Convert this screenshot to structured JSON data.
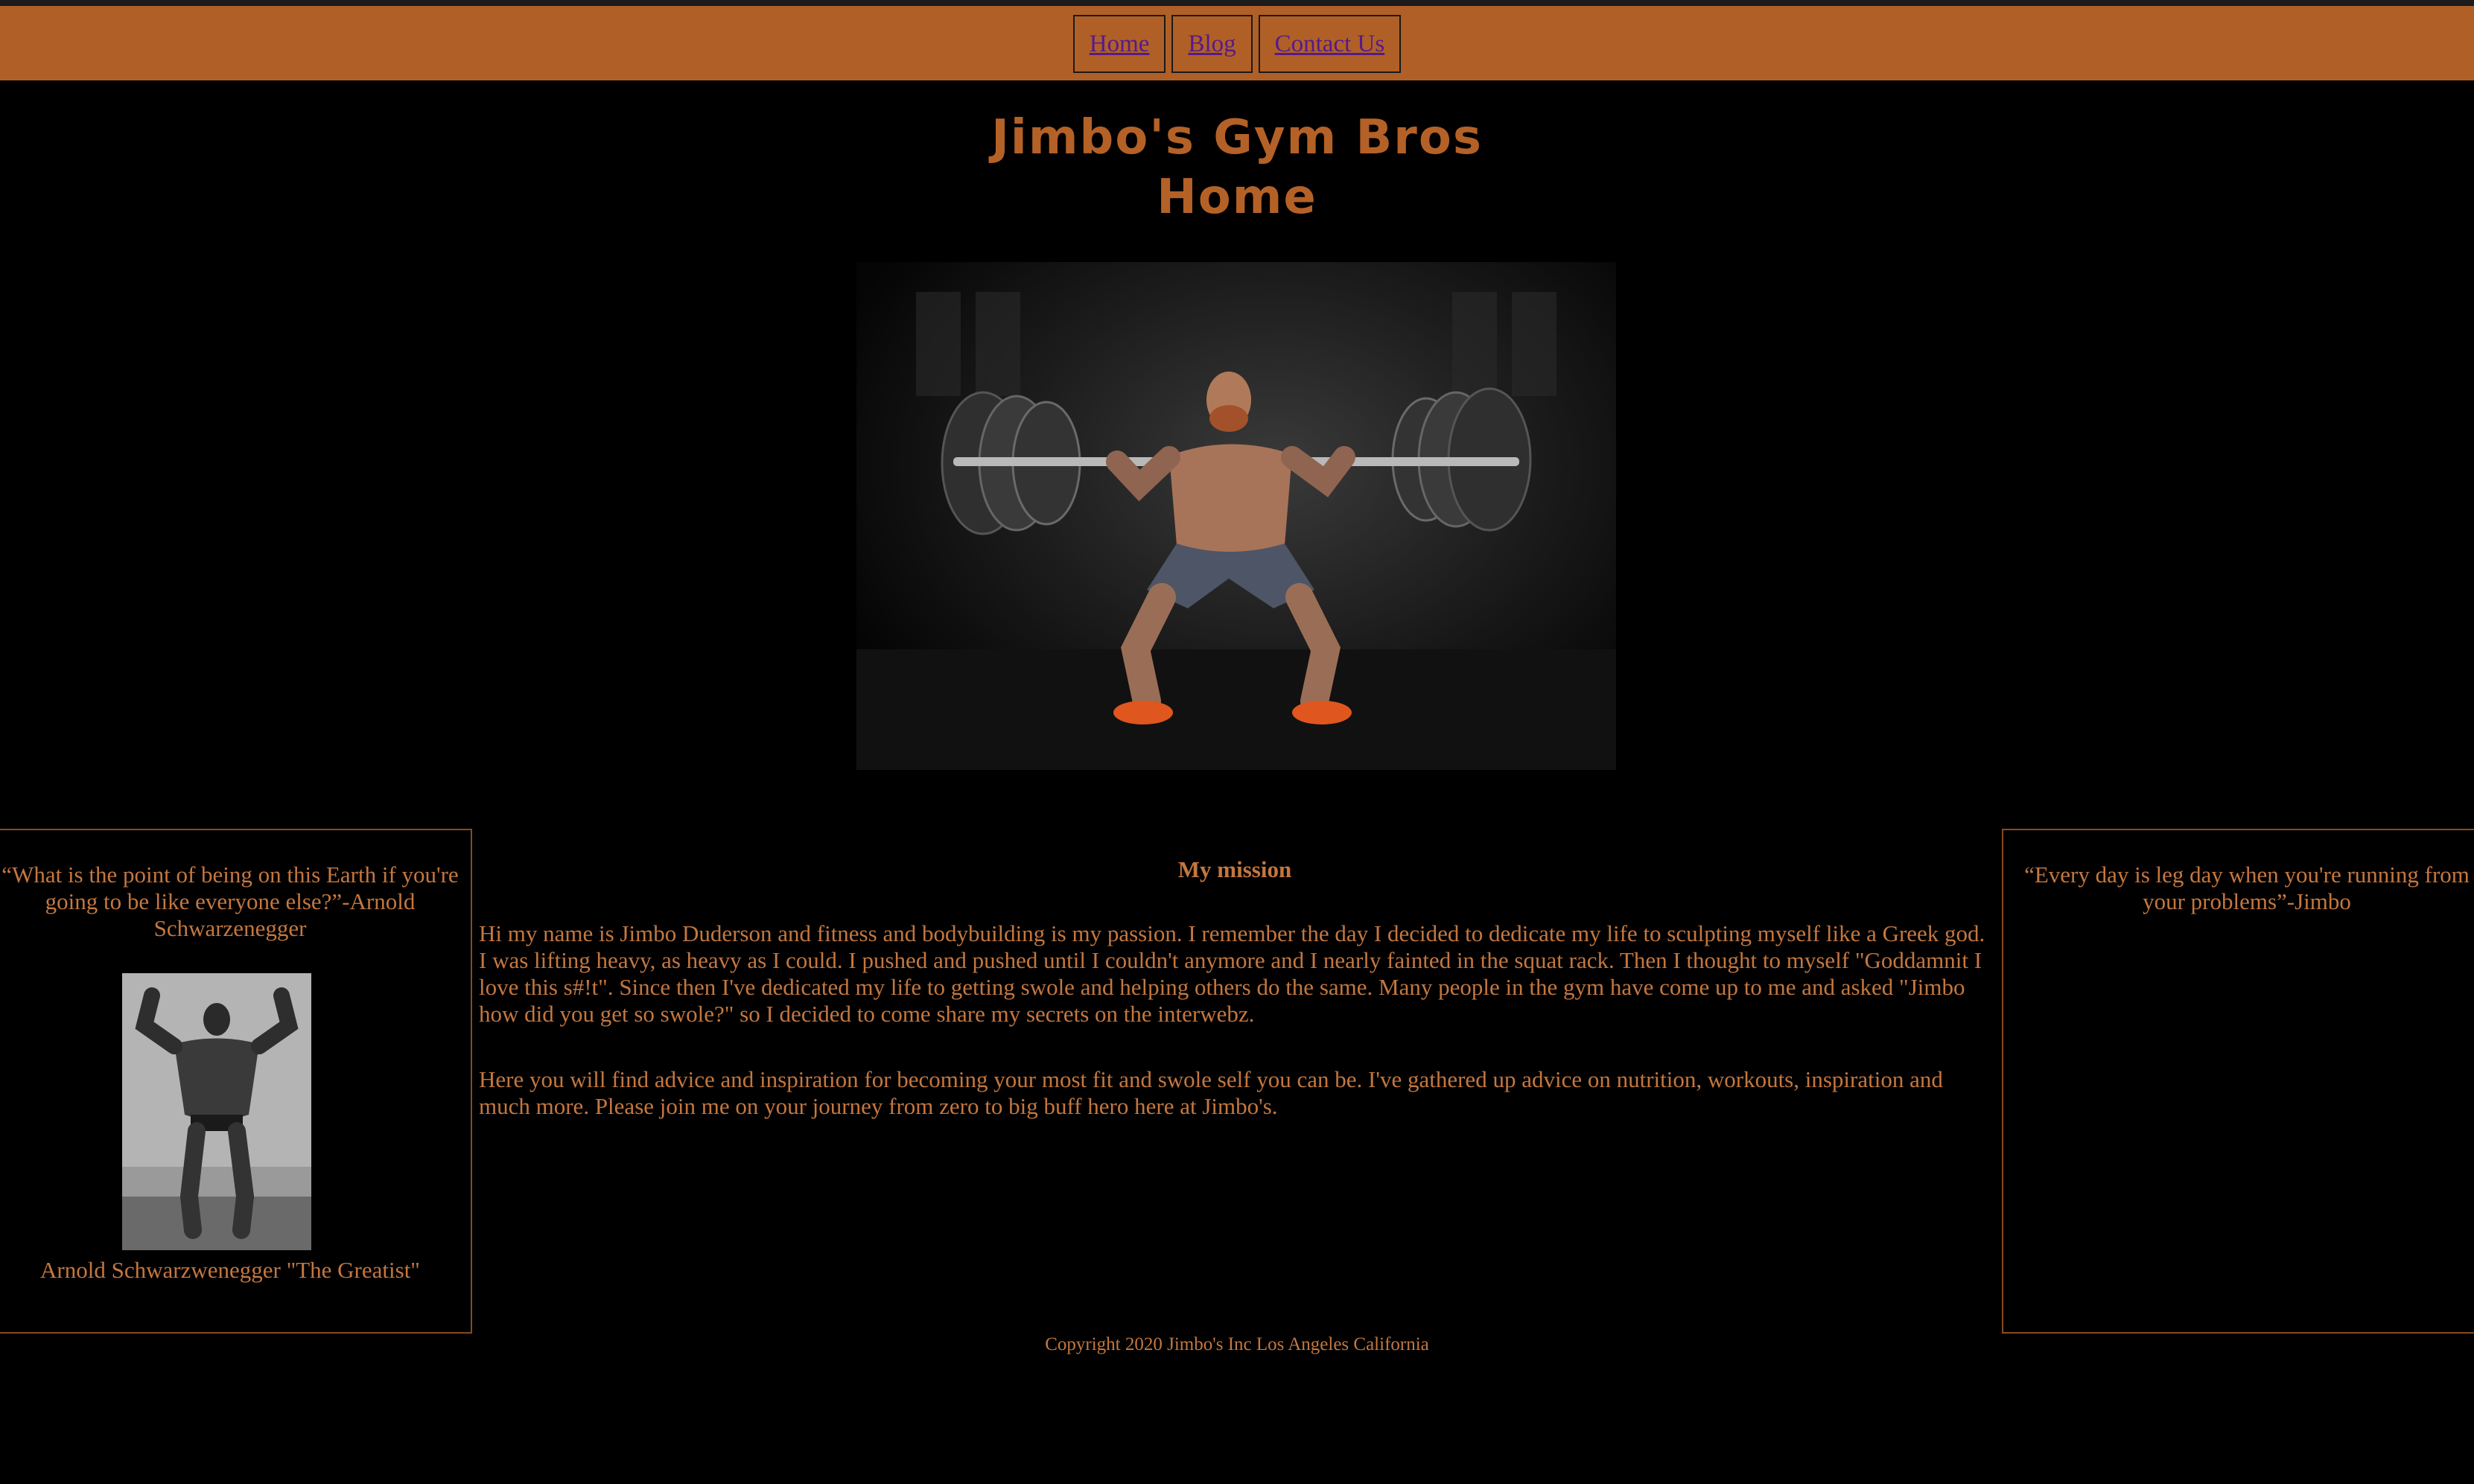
{
  "nav": {
    "items": [
      {
        "label": "Home"
      },
      {
        "label": "Blog"
      },
      {
        "label": "Contact Us"
      }
    ]
  },
  "header": {
    "title_line1": "Jimbo's Gym Bros",
    "title_line2": "Home"
  },
  "left_sidebar": {
    "quote": "“What is the point of being on this Earth if you're going to be like everyone else?”-Arnold Schwarzenegger",
    "caption": "Arnold Schwarzwenegger \"The Greatist\""
  },
  "right_sidebar": {
    "quote": "“Every day is leg day when you're running from your problems”-Jimbo"
  },
  "main": {
    "heading": "My mission",
    "paragraph1": "Hi my name is Jimbo Duderson and fitness and bodybuilding is my passion. I remember the day I decided to dedicate my life to sculpting myself like a Greek god. I was lifting heavy, as heavy as I could. I pushed and pushed until I couldn't anymore and I nearly fainted in the squat rack. Then I thought to myself \"Goddamnit I love this s#!t\". Since then I've dedicated my life to getting swole and helping others do the same. Many people in the gym have come up to me and asked \"Jimbo how did you get so swole?\" so I decided to come share my secrets on the interwebz.",
    "paragraph2": "Here you will find advice and inspiration for becoming your most fit and swole self you can be. I've gathered up advice on nutrition, workouts, inspiration and much more. Please join me on your journey from zero to big buff hero here at Jimbo's."
  },
  "footer": {
    "text": "Copyright 2020 Jimbo's Inc Los Angeles California"
  },
  "colors": {
    "navbar": "#b06027",
    "text": "#c4773f",
    "link": "#551a8b",
    "background": "#000000"
  }
}
